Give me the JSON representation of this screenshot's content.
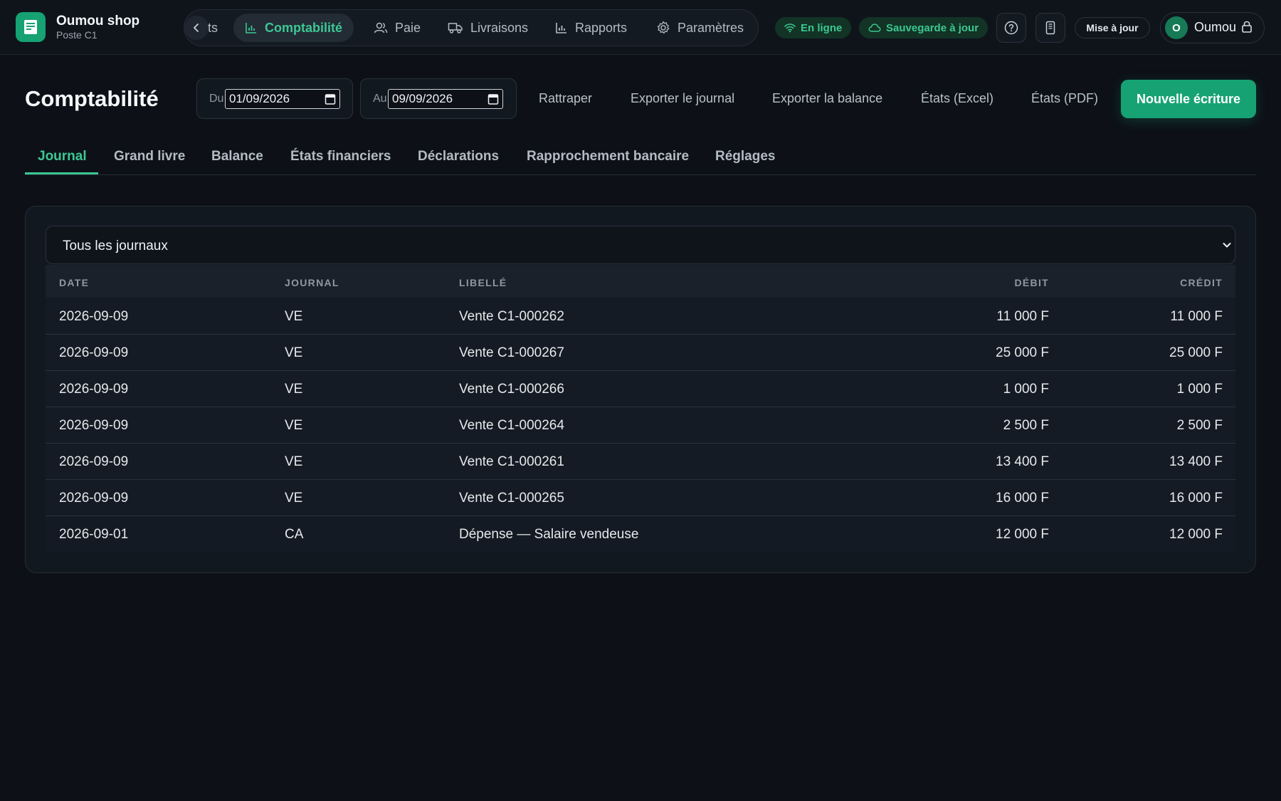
{
  "brand": {
    "name": "Oumou shop",
    "station": "Poste C1"
  },
  "nav": {
    "partial_label": "ts",
    "items": [
      {
        "label": "Comptabilité",
        "icon": "bar-chart-icon",
        "active": true
      },
      {
        "label": "Paie",
        "icon": "users-icon",
        "active": false
      },
      {
        "label": "Livraisons",
        "icon": "truck-icon",
        "active": false
      },
      {
        "label": "Rapports",
        "icon": "bar-chart-icon",
        "active": false
      },
      {
        "label": "Paramètres",
        "icon": "gear-icon",
        "active": false
      }
    ]
  },
  "status": {
    "online": "En ligne",
    "backup": "Sauvegarde à jour"
  },
  "topbar": {
    "update_label": "Mise à jour",
    "user_initial": "O",
    "user_name": "Oumou"
  },
  "page": {
    "title": "Comptabilité",
    "from_label": "Du",
    "from_value": "01/09/2026",
    "to_label": "Au",
    "to_value": "09/09/2026",
    "actions": [
      "Rattraper",
      "Exporter le journal",
      "Exporter la balance",
      "États (Excel)",
      "États (PDF)"
    ],
    "primary_action": "Nouvelle écriture"
  },
  "tabs": [
    {
      "label": "Journal",
      "active": true
    },
    {
      "label": "Grand livre",
      "active": false
    },
    {
      "label": "Balance",
      "active": false
    },
    {
      "label": "États financiers",
      "active": false
    },
    {
      "label": "Déclarations",
      "active": false
    },
    {
      "label": "Rapprochement bancaire",
      "active": false
    },
    {
      "label": "Réglages",
      "active": false
    }
  ],
  "journal": {
    "filter_value": "Tous les journaux",
    "columns": {
      "date": "DATE",
      "journal": "JOURNAL",
      "label": "LIBELLÉ",
      "debit": "DÉBIT",
      "credit": "CRÉDIT"
    },
    "rows": [
      {
        "date": "2026-09-09",
        "journal": "VE",
        "label": "Vente C1-000262",
        "debit": "11 000 F",
        "credit": "11 000 F"
      },
      {
        "date": "2026-09-09",
        "journal": "VE",
        "label": "Vente C1-000267",
        "debit": "25 000 F",
        "credit": "25 000 F"
      },
      {
        "date": "2026-09-09",
        "journal": "VE",
        "label": "Vente C1-000266",
        "debit": "1 000 F",
        "credit": "1 000 F"
      },
      {
        "date": "2026-09-09",
        "journal": "VE",
        "label": "Vente C1-000264",
        "debit": "2 500 F",
        "credit": "2 500 F"
      },
      {
        "date": "2026-09-09",
        "journal": "VE",
        "label": "Vente C1-000261",
        "debit": "13 400 F",
        "credit": "13 400 F"
      },
      {
        "date": "2026-09-09",
        "journal": "VE",
        "label": "Vente C1-000265",
        "debit": "16 000 F",
        "credit": "16 000 F"
      },
      {
        "date": "2026-09-01",
        "journal": "CA",
        "label": "Dépense — Salaire vendeuse",
        "debit": "12 000 F",
        "credit": "12 000 F"
      }
    ]
  },
  "colors": {
    "accent": "#3cc793",
    "primary": "#17a274",
    "background": "#0d1117"
  }
}
